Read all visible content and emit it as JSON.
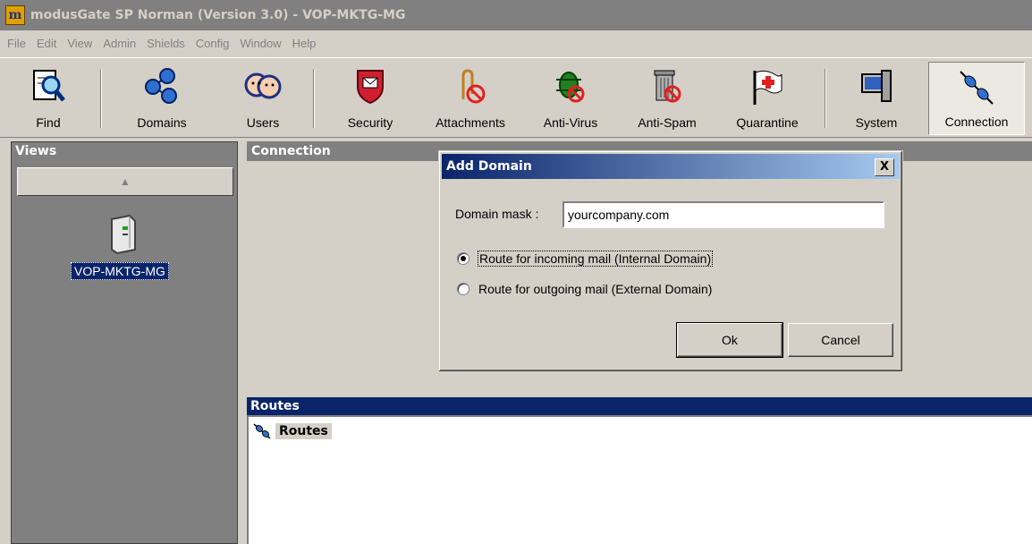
{
  "window": {
    "title": "modusGate SP Norman (Version 3.0) - VOP-MKTG-MG",
    "icon_letter": "m"
  },
  "menu": [
    "File",
    "Edit",
    "View",
    "Admin",
    "Shields",
    "Config",
    "Window",
    "Help"
  ],
  "toolbar": [
    {
      "label": "Find",
      "icon": "find-icon"
    },
    {
      "label": "Domains",
      "icon": "domains-icon"
    },
    {
      "label": "Users",
      "icon": "users-icon"
    },
    {
      "label": "Security",
      "icon": "security-shield-icon"
    },
    {
      "label": "Attachments",
      "icon": "attachments-icon"
    },
    {
      "label": "Anti-Virus",
      "icon": "anti-virus-icon"
    },
    {
      "label": "Anti-Spam",
      "icon": "anti-spam-icon"
    },
    {
      "label": "Quarantine",
      "icon": "quarantine-flag-icon"
    },
    {
      "label": "System",
      "icon": "system-icon"
    },
    {
      "label": "Connection",
      "icon": "connection-icon",
      "active": true
    }
  ],
  "views": {
    "title": "Views",
    "server_label": "VOP-MKTG-MG"
  },
  "connection": {
    "title": "Connection"
  },
  "routes": {
    "title": "Routes",
    "node_label": "Routes"
  },
  "dialog": {
    "title": "Add Domain",
    "close_label": "X",
    "mask_label": "Domain mask :",
    "mask_value": "yourcompany.com",
    "radio_incoming": "Route for incoming mail (Internal Domain)",
    "radio_outgoing": "Route for outgoing mail (External Domain)",
    "ok_label": "Ok",
    "cancel_label": "Cancel",
    "selected": "incoming"
  },
  "colors": {
    "selection": "#0a246a",
    "face": "#d4d0c8",
    "shadow": "#808080"
  }
}
